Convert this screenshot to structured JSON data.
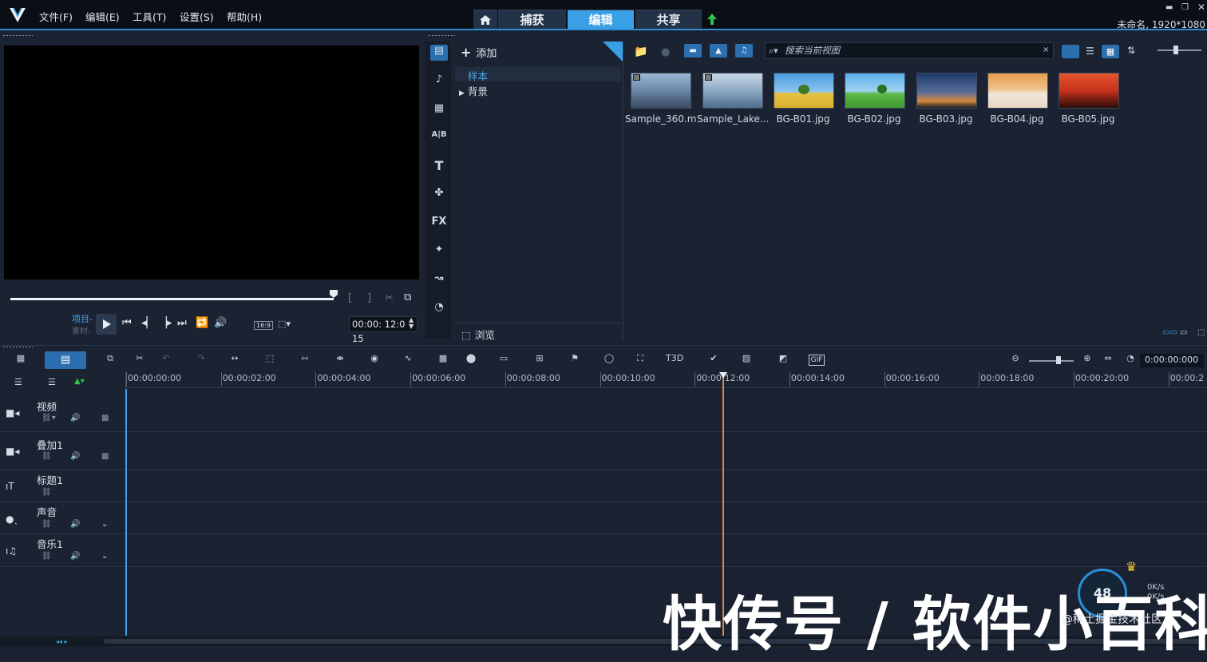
{
  "app": {
    "menu": [
      "文件(F)",
      "编辑(E)",
      "工具(T)",
      "设置(S)",
      "帮助(H)"
    ],
    "tabs": [
      {
        "label": "捕获",
        "active": false
      },
      {
        "label": "编辑",
        "active": true
      },
      {
        "label": "共享",
        "active": false
      }
    ],
    "window_title": "未命名, 1920*1080",
    "accent": "#3aa0e6",
    "icons": {
      "home": "home-icon",
      "upload": "upload-arrow-icon"
    }
  },
  "player": {
    "mode_project": "项目-",
    "mode_clip": "素材-",
    "aspect": "16:9",
    "timecode": "00:00: 12:0 15"
  },
  "library": {
    "add_label": "添加",
    "folders": [
      {
        "label": "样本",
        "selected": true
      },
      {
        "label": "背景",
        "selected": false
      }
    ],
    "browse_label": "浏览",
    "search_placeholder": "搜索当前视图",
    "side_icons": [
      "media",
      "music",
      "instant-project",
      "transition",
      "title",
      "graphics",
      "FX",
      "filter",
      "path",
      "speed"
    ],
    "fx_label": "FX",
    "items": [
      {
        "name": "Sample_360.m...",
        "type": "video",
        "colors": [
          "#9cb7d6",
          "#3a4b63"
        ]
      },
      {
        "name": "Sample_Lake...",
        "type": "video",
        "colors": [
          "#b7cde0",
          "#4e6d8c"
        ]
      },
      {
        "name": "BG-B01.jpg",
        "type": "image",
        "colors": [
          "#4a9de0",
          "#e7c247"
        ]
      },
      {
        "name": "BG-B02.jpg",
        "type": "image",
        "colors": [
          "#59aeea",
          "#3f9a33"
        ]
      },
      {
        "name": "BG-B03.jpg",
        "type": "image",
        "colors": [
          "#1f3a6a",
          "#d68a3c"
        ]
      },
      {
        "name": "BG-B04.jpg",
        "type": "image",
        "colors": [
          "#e59c4a",
          "#f1e7dc"
        ]
      },
      {
        "name": "BG-B05.jpg",
        "type": "image",
        "colors": [
          "#c8321c",
          "#2a0c08"
        ]
      }
    ]
  },
  "timeline": {
    "time_display": "0:00:00:000",
    "ruler": [
      "00:00:00:00",
      "00:00:02:00",
      "00:00:04:00",
      "00:00:06:00",
      "00:00:08:00",
      "00:00:10:00",
      "00:00:12:00",
      "00:00:14:00",
      "00:00:16:00",
      "00:00:18:00",
      "00:00:20:00",
      "00:00:2"
    ],
    "tracks": [
      {
        "name": "视频",
        "icon": "video-camera-icon"
      },
      {
        "name": "叠加1",
        "icon": "overlay-camera-icon"
      },
      {
        "name": "标题1",
        "icon": "title-icon"
      },
      {
        "name": "声音",
        "icon": "microphone-icon"
      },
      {
        "name": "音乐1",
        "icon": "music-note-icon"
      }
    ],
    "playhead_color": "#e08845",
    "title_3d_label": "T3D",
    "gif_label": "GIF"
  },
  "overlay": {
    "net_value": "48",
    "net_up": "0K/s",
    "net_down": "0K/s",
    "watermark": "快传号 / 软件小百科",
    "watermark_sub": "@稀土掘金技术社区"
  }
}
